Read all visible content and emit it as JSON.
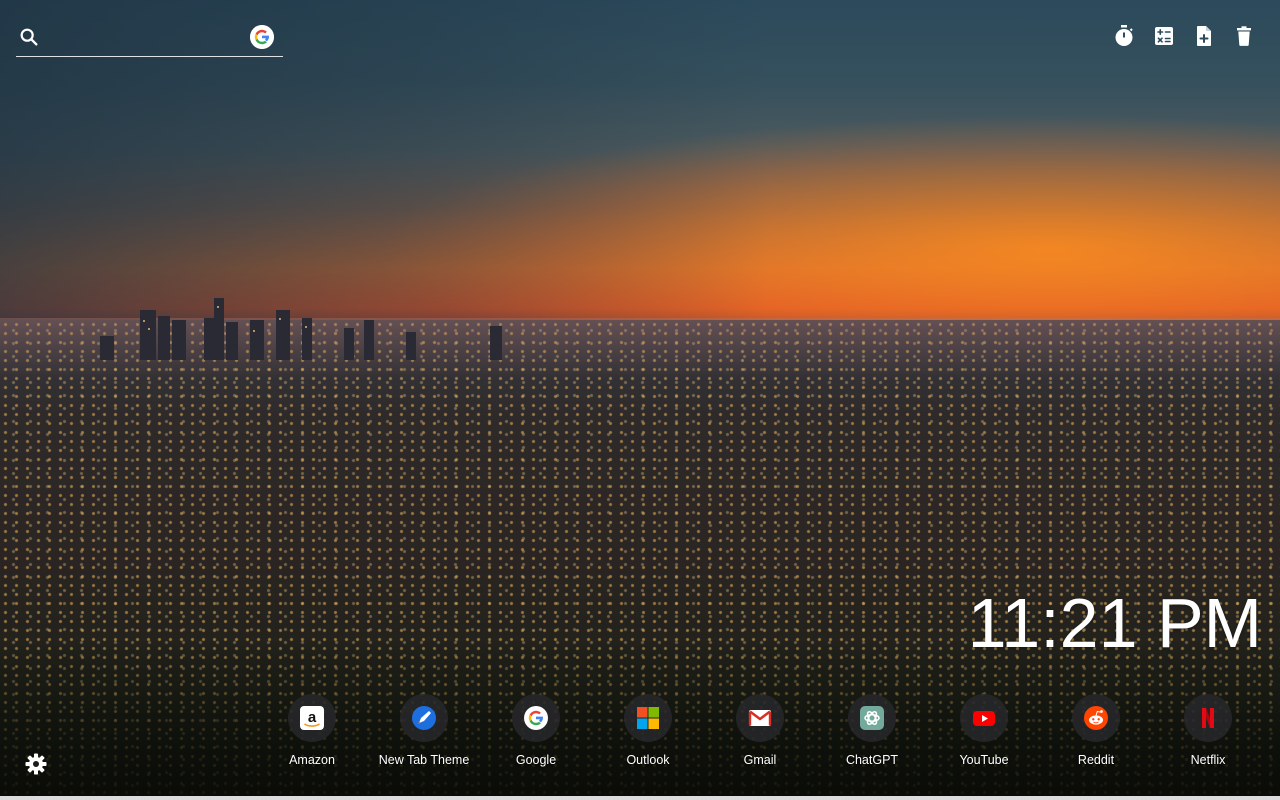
{
  "search": {
    "placeholder": "",
    "value": "",
    "engine_icon": "google-g-icon"
  },
  "toolbar": {
    "icons": [
      "stopwatch-icon",
      "calculator-icon",
      "new-note-icon",
      "trash-icon"
    ]
  },
  "clock": {
    "time": "11:21 PM"
  },
  "shortcuts": [
    {
      "label": "Amazon",
      "icon": "amazon-icon"
    },
    {
      "label": "New Tab Theme",
      "icon": "new-tab-theme-icon"
    },
    {
      "label": "Google",
      "icon": "google-icon"
    },
    {
      "label": "Outlook",
      "icon": "outlook-icon"
    },
    {
      "label": "Gmail",
      "icon": "gmail-icon"
    },
    {
      "label": "ChatGPT",
      "icon": "chatgpt-icon"
    },
    {
      "label": "YouTube",
      "icon": "youtube-icon"
    },
    {
      "label": "Reddit",
      "icon": "reddit-icon"
    },
    {
      "label": "Netflix",
      "icon": "netflix-icon"
    }
  ],
  "settings": {
    "icon": "gear-icon"
  },
  "colors": {
    "sky_top": "#2b4a5c",
    "sunset_orange": "#e8772a",
    "shortcut_bg": "#28282c",
    "text": "#ffffff"
  }
}
